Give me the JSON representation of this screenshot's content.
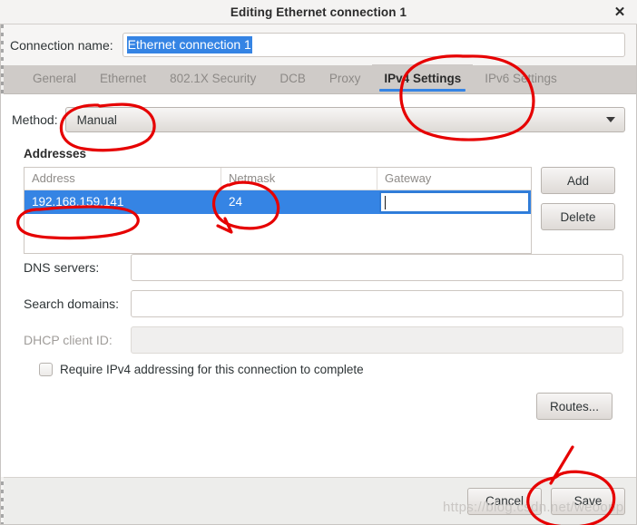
{
  "window": {
    "title": "Editing Ethernet connection 1",
    "close_icon": "close-icon",
    "close_glyph": "✕"
  },
  "connection": {
    "label": "Connection name:",
    "value": "Ethernet connection 1"
  },
  "tabs": [
    {
      "label": "General",
      "active": false
    },
    {
      "label": "Ethernet",
      "active": false
    },
    {
      "label": "802.1X Security",
      "active": false
    },
    {
      "label": "DCB",
      "active": false
    },
    {
      "label": "Proxy",
      "active": false
    },
    {
      "label": "IPv4 Settings",
      "active": true
    },
    {
      "label": "IPv6 Settings",
      "active": false
    }
  ],
  "method": {
    "label": "Method:",
    "value": "Manual",
    "arrow_icon": "chevron-down-icon"
  },
  "addresses": {
    "section_title": "Addresses",
    "columns": [
      "Address",
      "Netmask",
      "Gateway"
    ],
    "rows": [
      {
        "address": "192.168.159.141",
        "netmask": "24",
        "gateway": ""
      }
    ],
    "add_label": "Add",
    "delete_label": "Delete"
  },
  "fields": {
    "dns_label": "DNS servers:",
    "dns_value": "",
    "search_label": "Search domains:",
    "search_value": "",
    "dhcp_label": "DHCP client ID:",
    "dhcp_value": "",
    "require_label": "Require IPv4 addressing for this connection to complete",
    "require_checked": false
  },
  "buttons": {
    "routes": "Routes...",
    "cancel": "Cancel",
    "save": "Save"
  },
  "watermark": "https://blog.csdn.net/weoopp",
  "colors": {
    "accent_blue": "#3584e4",
    "annotation_red": "#e60000",
    "tabbar_gray": "#cfcbc8",
    "window_bg": "#f6f5f4"
  },
  "annotations": [
    {
      "name": "circle-ipv4-settings-tab",
      "shape": "ellipse"
    },
    {
      "name": "circle-method-manual",
      "shape": "ellipse"
    },
    {
      "name": "circle-address-value",
      "shape": "ellipse"
    },
    {
      "name": "circle-netmask-value",
      "shape": "ellipse"
    },
    {
      "name": "circle-save-button",
      "shape": "ellipse"
    },
    {
      "name": "arrow-routes-to-save",
      "shape": "line"
    }
  ]
}
